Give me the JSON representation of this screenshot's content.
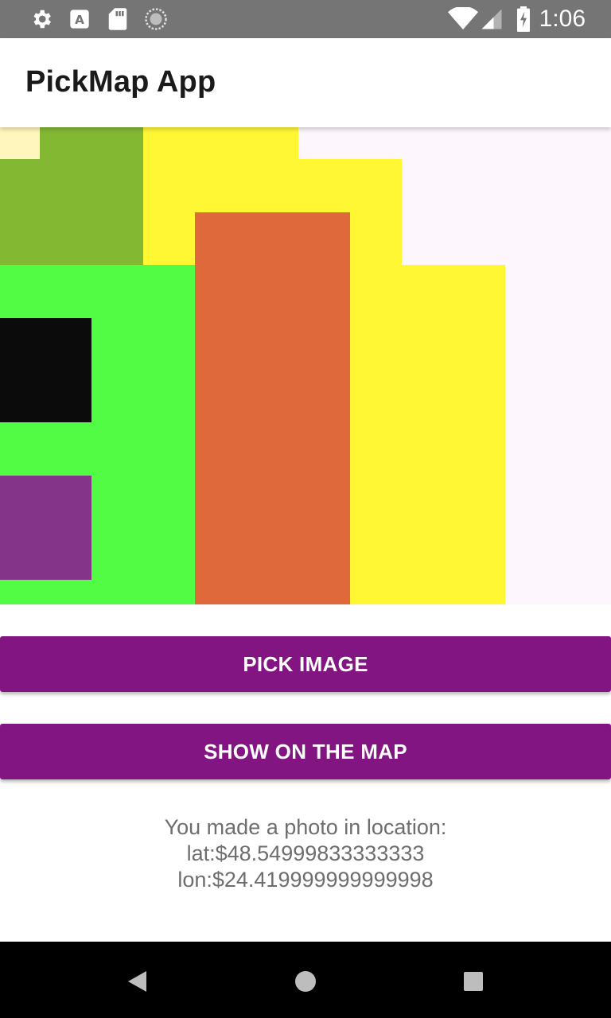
{
  "status_bar": {
    "time": "1:06",
    "left_icons": [
      "settings-icon",
      "text-a-icon",
      "sd-card-icon",
      "sync-icon"
    ],
    "right_icons": [
      "wifi-icon",
      "signal-icon",
      "battery-icon"
    ]
  },
  "app_bar": {
    "title": "PickMap App"
  },
  "photo": {
    "description_colors": {
      "background": "#fdf6fd",
      "yellow": "#fff733",
      "olive_green": "#83b833",
      "bright_green": "#52fc45",
      "orange": "#e0693c",
      "black": "#0b0b0b",
      "purple": "#84358a",
      "cream": "#fff6bd"
    }
  },
  "buttons": {
    "pick_image": "PICK IMAGE",
    "show_on_map": "SHOW ON THE MAP",
    "color": "#831583"
  },
  "location": {
    "line1": "You made a photo in location:",
    "line2": "lat:$48.54999833333333",
    "line3": "lon:$24.419999999999998"
  },
  "nav_bar": {
    "icons": [
      "back-icon",
      "home-icon",
      "recents-icon"
    ]
  }
}
